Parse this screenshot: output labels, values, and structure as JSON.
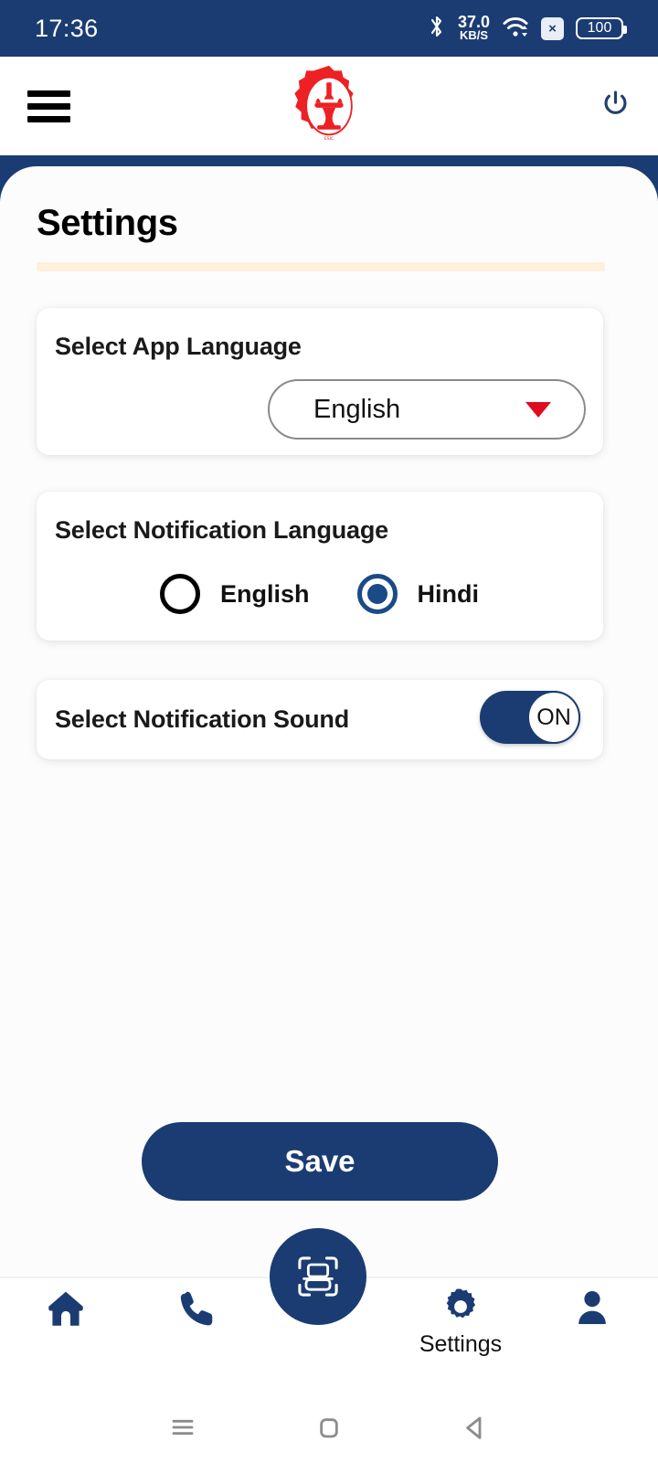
{
  "status_bar": {
    "time": "17:36",
    "network_speed_value": "37.0",
    "network_speed_unit": "KB/S",
    "bluetooth_icon": "bluetooth-icon",
    "wifi_icon": "wifi-icon",
    "sim_icon_label": "×",
    "battery_level": "100",
    "background_color": "#1b3c72"
  },
  "app_header": {
    "menu_icon": "hamburger-menu-icon",
    "logo_icon": "organization-logo",
    "logo_color": "#ed2024",
    "power_icon": "power-icon",
    "power_color": "#1b3c72"
  },
  "page": {
    "title": "Settings",
    "divider_color": "#fdf0dc",
    "accent_color": "#1b3c72"
  },
  "cards": {
    "app_language": {
      "label": "Select App Language",
      "dropdown_value": "English",
      "dropdown_caret_icon": "chevron-down-icon",
      "caret_color": "#e00b21"
    },
    "notification_language": {
      "label": "Select Notification Language",
      "options": [
        {
          "label": "English",
          "selected": false
        },
        {
          "label": "Hindi",
          "selected": true
        }
      ]
    },
    "notification_sound": {
      "label": "Select Notification Sound",
      "toggle_state": "ON",
      "toggle_on": true
    }
  },
  "save_button": {
    "label": "Save",
    "color": "#1b3c72"
  },
  "bottom_nav": {
    "items": [
      {
        "icon": "home-icon",
        "label": ""
      },
      {
        "icon": "phone-icon",
        "label": ""
      },
      {
        "icon": "scan-icon",
        "label": ""
      },
      {
        "icon": "gear-icon",
        "label": "Settings"
      },
      {
        "icon": "person-icon",
        "label": ""
      }
    ],
    "active_index": 3,
    "fab_icon": "scan-icon",
    "fab_color": "#1b3c72"
  },
  "system_nav": {
    "recents_icon": "recents-icon",
    "home_icon": "home-square-icon",
    "back_icon": "back-triangle-icon"
  }
}
